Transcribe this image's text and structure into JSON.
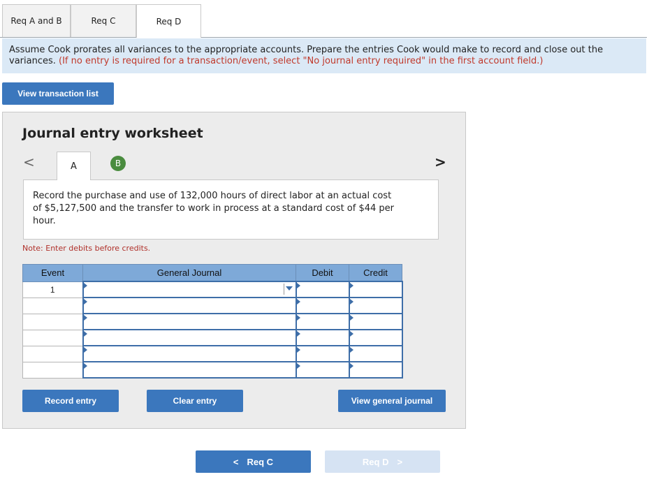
{
  "tabs": [
    {
      "label": "Req A and B"
    },
    {
      "label": "Req C"
    },
    {
      "label": "Req D"
    }
  ],
  "instruction": {
    "text": "Assume Cook prorates all variances to the appropriate accounts. Prepare the entries Cook would make to record and close out the variances.",
    "hint": "(If no entry is required for a transaction/event, select \"No journal entry required\" in the first account field.)"
  },
  "view_transaction_list": "View transaction list",
  "worksheet": {
    "title": "Journal entry worksheet",
    "prev_arrow": "<",
    "next_arrow": ">",
    "steps": [
      {
        "label": "A"
      },
      {
        "label": "B"
      }
    ],
    "description": "Record the purchase and use of 132,000 hours of direct labor at an actual cost of $5,127,500 and the transfer to work in process at a standard cost of $44 per hour.",
    "note": "Note: Enter debits before credits.",
    "table": {
      "headers": [
        "Event",
        "General Journal",
        "Debit",
        "Credit"
      ],
      "rows": [
        {
          "event": "1",
          "account": "",
          "debit": "",
          "credit": ""
        },
        {
          "event": "",
          "account": "",
          "debit": "",
          "credit": ""
        },
        {
          "event": "",
          "account": "",
          "debit": "",
          "credit": ""
        },
        {
          "event": "",
          "account": "",
          "debit": "",
          "credit": ""
        },
        {
          "event": "",
          "account": "",
          "debit": "",
          "credit": ""
        },
        {
          "event": "",
          "account": "",
          "debit": "",
          "credit": ""
        }
      ]
    },
    "record_entry": "Record entry",
    "clear_entry": "Clear entry",
    "view_general_journal": "View general journal"
  },
  "nav": {
    "prev_label": "Req C",
    "next_label": "Req D",
    "prev_icon": "<",
    "next_icon": ">"
  },
  "colors": {
    "primary_button": "#3b77bd",
    "disabled_button": "#d6e3f3",
    "header_blue": "#7ea9d8",
    "instruction_bg": "#dbe9f6",
    "hint_red": "#c0392b",
    "step_green": "#4a8c3f"
  }
}
